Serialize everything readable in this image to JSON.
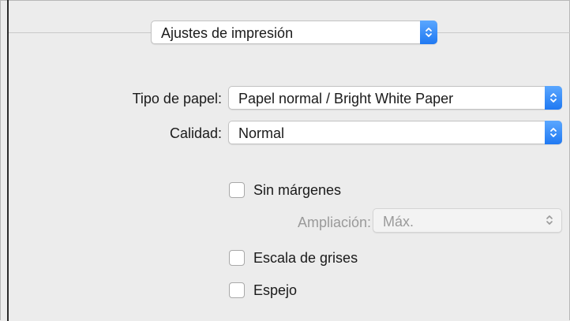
{
  "header": {
    "preset_value": "Ajustes de impresión"
  },
  "form": {
    "paper_type": {
      "label": "Tipo de papel:",
      "value": "Papel normal / Bright White Paper"
    },
    "quality": {
      "label": "Calidad:",
      "value": "Normal"
    }
  },
  "options": {
    "borderless": {
      "label": "Sin márgenes",
      "checked": false
    },
    "expansion": {
      "label": "Ampliación:",
      "value": "Máx.",
      "enabled": false
    },
    "grayscale": {
      "label": "Escala de grises",
      "checked": false
    },
    "mirror": {
      "label": "Espejo",
      "checked": false
    }
  },
  "icons": {
    "popup_arrows": "updown-chevron-icon"
  },
  "colors": {
    "accent": "#2f86f6",
    "panel_bg": "#ececec"
  }
}
